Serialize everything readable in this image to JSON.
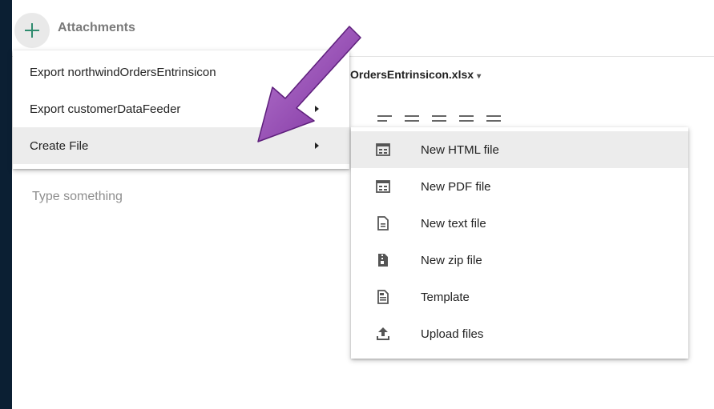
{
  "attachments": {
    "label": "Attachments",
    "icon": "plus-icon"
  },
  "editor": {
    "file_title": "OrdersEntrinsicon.xlsx",
    "file_title_caret": "▾",
    "placeholder": "Type something",
    "toolbar_icons": [
      "align-icon",
      "numbered-list-icon",
      "bullet-list-icon",
      "outdent-icon",
      "indent-icon",
      "clear-format-icon",
      "special-char-icon"
    ]
  },
  "menu": {
    "items": [
      {
        "label": "Export northwindOrdersEntrinsicon",
        "has_submenu": false
      },
      {
        "label": "Export customerDataFeeder",
        "has_submenu": true
      },
      {
        "label": "Create File",
        "has_submenu": true,
        "active": true
      }
    ]
  },
  "submenu": {
    "items": [
      {
        "label": "New HTML file",
        "icon": "html-file-icon",
        "active": true
      },
      {
        "label": "New PDF file",
        "icon": "pdf-file-icon"
      },
      {
        "label": "New text file",
        "icon": "text-file-icon"
      },
      {
        "label": "New zip file",
        "icon": "zip-file-icon"
      },
      {
        "label": "Template",
        "icon": "template-icon"
      },
      {
        "label": "Upload files",
        "icon": "upload-icon"
      }
    ]
  },
  "colors": {
    "frame": "#0b1f33",
    "accent_green": "#2e8b6e",
    "arrow_purple": "#8a3fa8",
    "icon_gray": "#555555"
  }
}
